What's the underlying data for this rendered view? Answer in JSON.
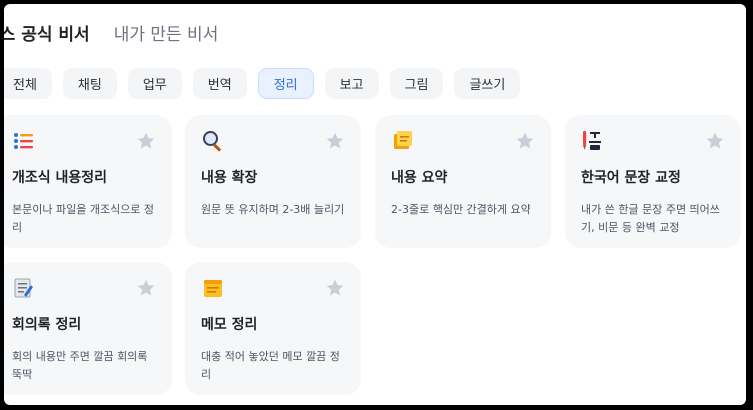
{
  "header": {
    "official_tab": "닉스 공식 비서",
    "my_tab": "내가 만든 비서"
  },
  "chips": [
    {
      "label": "전체",
      "active": false
    },
    {
      "label": "채팅",
      "active": false
    },
    {
      "label": "업무",
      "active": false
    },
    {
      "label": "번역",
      "active": false
    },
    {
      "label": "정리",
      "active": true
    },
    {
      "label": "보고",
      "active": false
    },
    {
      "label": "그림",
      "active": false
    },
    {
      "label": "글쓰기",
      "active": false
    }
  ],
  "cards": [
    {
      "title": "개조식 내용정리",
      "desc": "본문이나 파일을 개조식으로 정리",
      "icon": "list-icon"
    },
    {
      "title": "내용 확장",
      "desc": "원문 뜻 유지하며 2-3배 늘리기",
      "icon": "magnifier-icon"
    },
    {
      "title": "내용 요약",
      "desc": "2-3줄로 핵심만 간결하게 요약",
      "icon": "sticky-note-icon"
    },
    {
      "title": "한국어 문장 교정",
      "desc": "내가 쓴 한글 문장 주면 띄어쓰기, 비문 등 완벽 교정",
      "icon": "correction-icon"
    },
    {
      "title": "회의록 정리",
      "desc": "회의 내용만 주면 깔끔 회의록 뚝딱",
      "icon": "memo-icon"
    },
    {
      "title": "메모 정리",
      "desc": "대충 적어 놓았던 메모 깔끔 정리",
      "icon": "note-icon"
    }
  ]
}
